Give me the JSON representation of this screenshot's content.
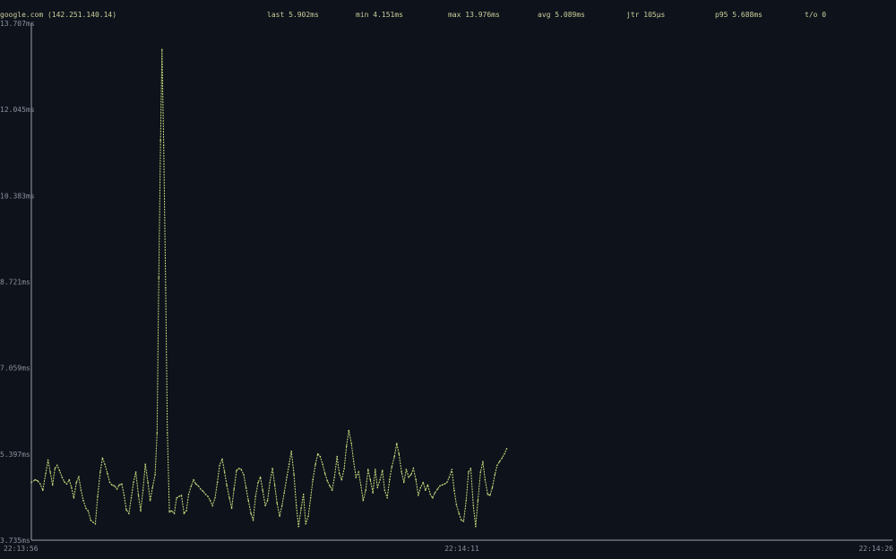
{
  "header": {
    "target": "google.com (142.251.140.14)",
    "last": "last 5.902ms",
    "min": "min 4.151ms",
    "max": "max 13.976ms",
    "avg": "avg 5.089ms",
    "jitter": "jtr 105µs",
    "p95": "p95 5.688ms",
    "timeouts": "t/o 0"
  },
  "colors": {
    "background": "#0e121b",
    "header_text": "#c9cf9a",
    "series": "#c4d67a",
    "axis": "#9aa0aa",
    "tick_text": "#8a8f9c"
  },
  "chart_data": {
    "type": "line",
    "title": "",
    "xlabel": "",
    "ylabel": "",
    "grid": false,
    "style": "braille-dotted",
    "ylim": [
      3.735,
      13.707
    ],
    "y_ticks": [
      "13.707ms",
      "12.045ms",
      "10.383ms",
      "8.721ms",
      "7.059ms",
      "5.397ms",
      "3.735ms"
    ],
    "y_tick_values": [
      13.707,
      12.045,
      10.383,
      8.721,
      7.059,
      5.397,
      3.735
    ],
    "x_ticks": [
      "22:13:56",
      "22:14:11",
      "22:14:26"
    ],
    "x_tick_seconds": [
      0,
      15,
      30
    ],
    "xlim_seconds": [
      0,
      30
    ],
    "series": [
      {
        "values": [
          [
            0.0,
            4.85
          ],
          [
            0.13,
            4.9
          ],
          [
            0.22,
            4.88
          ],
          [
            0.31,
            4.82
          ],
          [
            0.4,
            4.7
          ],
          [
            0.5,
            5.02
          ],
          [
            0.58,
            5.28
          ],
          [
            0.66,
            5.05
          ],
          [
            0.74,
            4.8
          ],
          [
            0.82,
            5.12
          ],
          [
            0.9,
            5.18
          ],
          [
            0.98,
            5.08
          ],
          [
            1.07,
            4.95
          ],
          [
            1.15,
            4.86
          ],
          [
            1.23,
            4.82
          ],
          [
            1.32,
            4.9
          ],
          [
            1.4,
            4.75
          ],
          [
            1.48,
            4.55
          ],
          [
            1.57,
            4.85
          ],
          [
            1.65,
            4.96
          ],
          [
            1.73,
            4.7
          ],
          [
            1.81,
            4.5
          ],
          [
            1.9,
            4.35
          ],
          [
            1.98,
            4.3
          ],
          [
            2.07,
            4.12
          ],
          [
            2.15,
            4.08
          ],
          [
            2.23,
            4.05
          ],
          [
            2.31,
            4.58
          ],
          [
            2.4,
            5.05
          ],
          [
            2.48,
            5.32
          ],
          [
            2.56,
            5.2
          ],
          [
            2.65,
            5.02
          ],
          [
            2.73,
            4.85
          ],
          [
            2.81,
            4.8
          ],
          [
            2.9,
            4.78
          ],
          [
            2.98,
            4.72
          ],
          [
            3.06,
            4.8
          ],
          [
            3.15,
            4.82
          ],
          [
            3.23,
            4.6
          ],
          [
            3.31,
            4.32
          ],
          [
            3.4,
            4.25
          ],
          [
            3.48,
            4.55
          ],
          [
            3.56,
            4.85
          ],
          [
            3.64,
            5.05
          ],
          [
            3.73,
            4.6
          ],
          [
            3.81,
            4.3
          ],
          [
            3.89,
            4.7
          ],
          [
            3.97,
            5.2
          ],
          [
            4.06,
            4.85
          ],
          [
            4.14,
            4.5
          ],
          [
            4.22,
            4.75
          ],
          [
            4.31,
            5.0
          ],
          [
            4.38,
            5.8
          ],
          [
            4.44,
            8.8
          ],
          [
            4.5,
            11.45
          ],
          [
            4.55,
            13.2
          ],
          [
            4.61,
            11.35
          ],
          [
            4.68,
            8.6
          ],
          [
            4.74,
            5.8
          ],
          [
            4.81,
            4.28
          ],
          [
            4.89,
            4.3
          ],
          [
            4.98,
            4.25
          ],
          [
            5.06,
            4.55
          ],
          [
            5.15,
            4.58
          ],
          [
            5.23,
            4.6
          ],
          [
            5.32,
            4.25
          ],
          [
            5.4,
            4.3
          ],
          [
            5.48,
            4.62
          ],
          [
            5.57,
            4.78
          ],
          [
            5.65,
            4.9
          ],
          [
            5.73,
            4.82
          ],
          [
            5.82,
            4.78
          ],
          [
            5.9,
            4.72
          ],
          [
            5.98,
            4.68
          ],
          [
            6.07,
            4.62
          ],
          [
            6.15,
            4.58
          ],
          [
            6.23,
            4.5
          ],
          [
            6.31,
            4.4
          ],
          [
            6.4,
            4.55
          ],
          [
            6.48,
            4.85
          ],
          [
            6.56,
            5.18
          ],
          [
            6.65,
            5.3
          ],
          [
            6.73,
            5.05
          ],
          [
            6.81,
            4.8
          ],
          [
            6.9,
            4.55
          ],
          [
            6.98,
            4.35
          ],
          [
            7.06,
            4.72
          ],
          [
            7.15,
            5.08
          ],
          [
            7.23,
            5.12
          ],
          [
            7.31,
            5.1
          ],
          [
            7.4,
            5.0
          ],
          [
            7.48,
            4.75
          ],
          [
            7.56,
            4.5
          ],
          [
            7.65,
            4.25
          ],
          [
            7.73,
            4.12
          ],
          [
            7.81,
            4.58
          ],
          [
            7.9,
            4.85
          ],
          [
            7.98,
            4.95
          ],
          [
            8.06,
            4.7
          ],
          [
            8.15,
            4.4
          ],
          [
            8.23,
            4.5
          ],
          [
            8.31,
            4.85
          ],
          [
            8.4,
            5.12
          ],
          [
            8.48,
            4.8
          ],
          [
            8.56,
            4.45
          ],
          [
            8.65,
            4.2
          ],
          [
            8.73,
            4.4
          ],
          [
            8.81,
            4.65
          ],
          [
            8.9,
            4.95
          ],
          [
            8.98,
            5.2
          ],
          [
            9.06,
            5.45
          ],
          [
            9.15,
            5.0
          ],
          [
            9.23,
            4.4
          ],
          [
            9.31,
            4.0
          ],
          [
            9.4,
            4.35
          ],
          [
            9.48,
            4.62
          ],
          [
            9.56,
            4.05
          ],
          [
            9.65,
            4.2
          ],
          [
            9.73,
            4.55
          ],
          [
            9.81,
            4.9
          ],
          [
            9.9,
            5.2
          ],
          [
            9.98,
            5.4
          ],
          [
            10.06,
            5.35
          ],
          [
            10.15,
            5.2
          ],
          [
            10.23,
            5.02
          ],
          [
            10.31,
            4.88
          ],
          [
            10.4,
            4.78
          ],
          [
            10.48,
            4.7
          ],
          [
            10.56,
            4.95
          ],
          [
            10.65,
            5.35
          ],
          [
            10.73,
            5.02
          ],
          [
            10.81,
            4.9
          ],
          [
            10.9,
            5.12
          ],
          [
            10.98,
            5.55
          ],
          [
            11.06,
            5.85
          ],
          [
            11.15,
            5.6
          ],
          [
            11.23,
            5.25
          ],
          [
            11.31,
            4.95
          ],
          [
            11.4,
            5.05
          ],
          [
            11.48,
            4.8
          ],
          [
            11.56,
            4.5
          ],
          [
            11.65,
            4.7
          ],
          [
            11.73,
            5.1
          ],
          [
            11.81,
            4.9
          ],
          [
            11.9,
            4.65
          ],
          [
            11.98,
            5.1
          ],
          [
            12.06,
            4.75
          ],
          [
            12.15,
            4.9
          ],
          [
            12.23,
            5.08
          ],
          [
            12.31,
            4.7
          ],
          [
            12.4,
            4.55
          ],
          [
            12.48,
            4.9
          ],
          [
            12.56,
            5.15
          ],
          [
            12.65,
            5.35
          ],
          [
            12.73,
            5.6
          ],
          [
            12.81,
            5.4
          ],
          [
            12.9,
            5.05
          ],
          [
            12.98,
            4.85
          ],
          [
            13.06,
            5.1
          ],
          [
            13.15,
            4.95
          ],
          [
            13.23,
            5.0
          ],
          [
            13.31,
            5.12
          ],
          [
            13.4,
            4.9
          ],
          [
            13.48,
            4.6
          ],
          [
            13.56,
            4.75
          ],
          [
            13.65,
            4.85
          ],
          [
            13.73,
            4.7
          ],
          [
            13.81,
            4.8
          ],
          [
            13.9,
            4.62
          ],
          [
            13.98,
            4.55
          ],
          [
            14.06,
            4.65
          ],
          [
            14.15,
            4.72
          ],
          [
            14.23,
            4.78
          ],
          [
            14.31,
            4.8
          ],
          [
            14.4,
            4.82
          ],
          [
            14.48,
            4.85
          ],
          [
            14.56,
            4.95
          ],
          [
            14.65,
            5.1
          ],
          [
            14.73,
            4.7
          ],
          [
            14.81,
            4.42
          ],
          [
            14.9,
            4.25
          ],
          [
            14.98,
            4.12
          ],
          [
            15.06,
            4.1
          ],
          [
            15.15,
            4.5
          ],
          [
            15.23,
            5.05
          ],
          [
            15.31,
            5.12
          ],
          [
            15.4,
            4.4
          ],
          [
            15.48,
            4.0
          ],
          [
            15.56,
            4.5
          ],
          [
            15.65,
            5.05
          ],
          [
            15.73,
            5.25
          ],
          [
            15.81,
            4.9
          ],
          [
            15.9,
            4.62
          ],
          [
            15.98,
            4.6
          ],
          [
            16.06,
            4.75
          ],
          [
            16.15,
            5.0
          ],
          [
            16.23,
            5.18
          ],
          [
            16.31,
            5.25
          ],
          [
            16.4,
            5.32
          ],
          [
            16.48,
            5.4
          ],
          [
            16.56,
            5.5
          ]
        ]
      }
    ]
  }
}
